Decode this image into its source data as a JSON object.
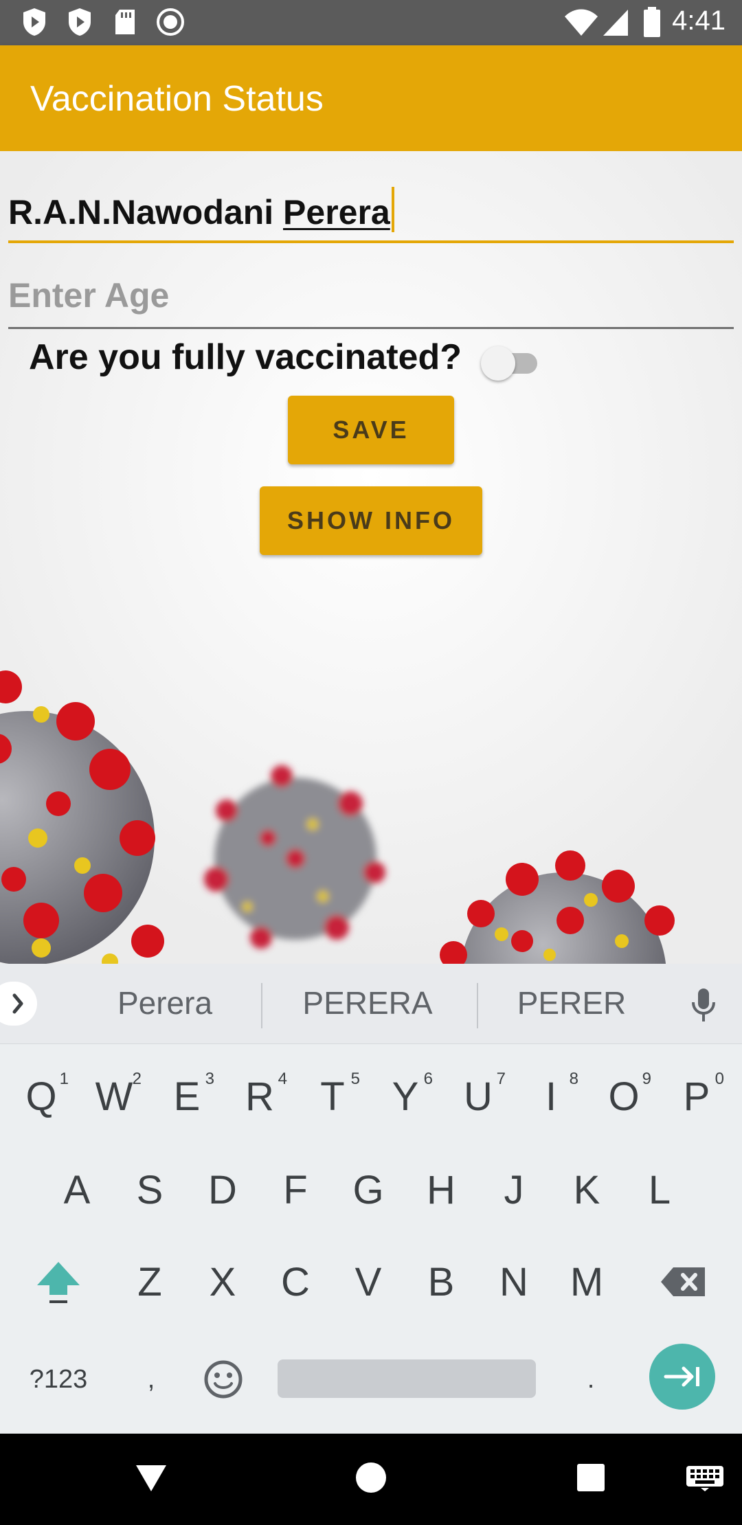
{
  "status_bar": {
    "time": "4:41",
    "left_icons": [
      "shield-play-icon",
      "play-protect-icon",
      "sd-card-icon",
      "record-icon"
    ],
    "right_icons": [
      "wifi-icon",
      "cell-signal-icon",
      "battery-icon"
    ]
  },
  "app_bar": {
    "title": "Vaccination Status",
    "color": "#e4a707"
  },
  "form": {
    "name_value_prefix": "R.A.N.Nawodani ",
    "name_value_composing": "Perera",
    "age_placeholder": "Enter Age",
    "vaccinated_label": "Are you fully vaccinated?",
    "vaccinated_on": false,
    "save_label": "SAVE",
    "show_info_label": "SHOW INFO"
  },
  "keyboard": {
    "suggestions": [
      "Perera",
      "PERERA",
      "PERER"
    ],
    "row1": [
      {
        "label": "Q",
        "hint": "1"
      },
      {
        "label": "W",
        "hint": "2"
      },
      {
        "label": "E",
        "hint": "3"
      },
      {
        "label": "R",
        "hint": "4"
      },
      {
        "label": "T",
        "hint": "5"
      },
      {
        "label": "Y",
        "hint": "6"
      },
      {
        "label": "U",
        "hint": "7"
      },
      {
        "label": "I",
        "hint": "8"
      },
      {
        "label": "O",
        "hint": "9"
      },
      {
        "label": "P",
        "hint": "0"
      }
    ],
    "row2": [
      "A",
      "S",
      "D",
      "F",
      "G",
      "H",
      "J",
      "K",
      "L"
    ],
    "row3": [
      "Z",
      "X",
      "C",
      "V",
      "B",
      "N",
      "M"
    ],
    "symbols_label": "?123",
    "comma_label": ",",
    "period_label": ".",
    "accent_color": "#4db6ac"
  },
  "nav_bar": {
    "icons": [
      "back-icon",
      "home-icon",
      "recents-icon",
      "keyboard-switch-icon"
    ]
  }
}
